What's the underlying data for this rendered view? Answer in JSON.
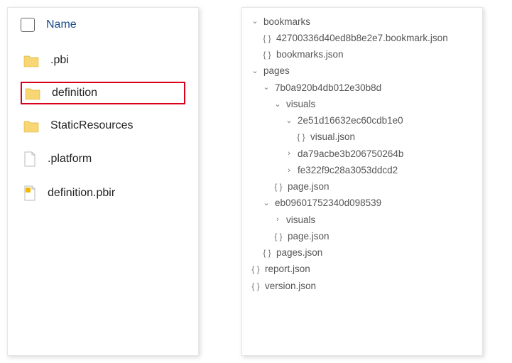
{
  "fileList": {
    "columnHeader": "Name",
    "items": [
      {
        "name": ".pbi",
        "type": "folder",
        "highlight": false
      },
      {
        "name": "definition",
        "type": "folder",
        "highlight": true
      },
      {
        "name": "StaticResources",
        "type": "folder",
        "highlight": false
      },
      {
        "name": ".platform",
        "type": "file-blank",
        "highlight": false
      },
      {
        "name": "definition.pbir",
        "type": "file-pbir",
        "highlight": false
      }
    ]
  },
  "tree": [
    {
      "indent": 0,
      "kind": "folder-open",
      "label": "bookmarks"
    },
    {
      "indent": 1,
      "kind": "json",
      "label": "42700336d40ed8b8e2e7.bookmark.json"
    },
    {
      "indent": 1,
      "kind": "json",
      "label": "bookmarks.json"
    },
    {
      "indent": 0,
      "kind": "folder-open",
      "label": "pages"
    },
    {
      "indent": 1,
      "kind": "folder-open",
      "label": "7b0a920b4db012e30b8d"
    },
    {
      "indent": 2,
      "kind": "folder-open",
      "label": "visuals"
    },
    {
      "indent": 3,
      "kind": "folder-open",
      "label": "2e51d16632ec60cdb1e0"
    },
    {
      "indent": 4,
      "kind": "json",
      "label": "visual.json"
    },
    {
      "indent": 3,
      "kind": "folder-closed",
      "label": "da79acbe3b206750264b"
    },
    {
      "indent": 3,
      "kind": "folder-closed",
      "label": "fe322f9c28a3053ddcd2"
    },
    {
      "indent": 2,
      "kind": "json",
      "label": "page.json"
    },
    {
      "indent": 1,
      "kind": "folder-open",
      "label": "eb09601752340d098539"
    },
    {
      "indent": 2,
      "kind": "folder-closed",
      "label": "visuals"
    },
    {
      "indent": 2,
      "kind": "json",
      "label": "page.json"
    },
    {
      "indent": 1,
      "kind": "json",
      "label": "pages.json"
    },
    {
      "indent": 0,
      "kind": "json",
      "label": "report.json"
    },
    {
      "indent": 0,
      "kind": "json",
      "label": "version.json"
    }
  ]
}
